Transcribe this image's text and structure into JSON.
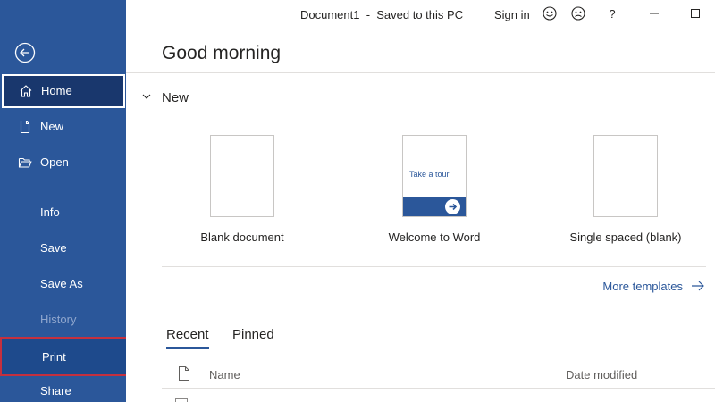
{
  "titlebar": {
    "doc_title": "Document1  -  Saved to this PC",
    "signin": "Sign in",
    "icons": [
      "smile-icon",
      "frown-icon",
      "help-icon",
      "minimize-icon",
      "maximize-icon"
    ]
  },
  "sidebar": {
    "back_icon": "back-arrow-icon",
    "items": [
      {
        "label": "Home",
        "icon": "home-icon"
      },
      {
        "label": "New",
        "icon": "new-document-icon"
      },
      {
        "label": "Open",
        "icon": "open-folder-icon"
      },
      {
        "label": "Info"
      },
      {
        "label": "Save"
      },
      {
        "label": "Save As"
      },
      {
        "label": "History",
        "disabled": true
      },
      {
        "label": "Print"
      },
      {
        "label": "Share"
      }
    ]
  },
  "main": {
    "greeting": "Good morning",
    "new_section": {
      "title": "New",
      "templates": [
        {
          "label": "Blank document"
        },
        {
          "label": "Welcome to Word",
          "thumb_text": "Take a tour"
        },
        {
          "label": "Single spaced (blank)"
        }
      ],
      "more_templates": "More templates"
    },
    "tabs": [
      "Recent",
      "Pinned"
    ],
    "active_tab": "Recent",
    "columns": {
      "name": "Name",
      "date": "Date modified"
    }
  },
  "colors": {
    "accent": "#2b579a",
    "sidebar": "#2b579a",
    "highlight_border": "#c5303e"
  }
}
